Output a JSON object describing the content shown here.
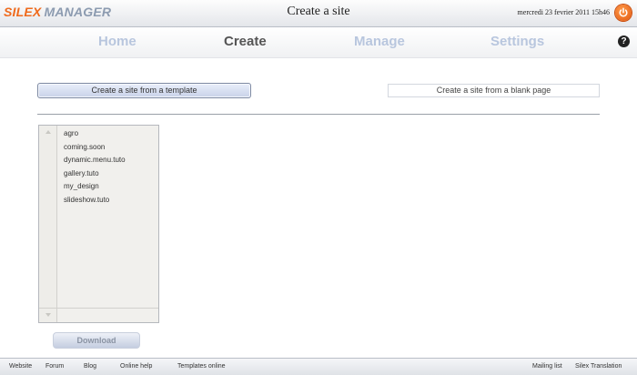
{
  "header": {
    "logo_part1": "SILEX",
    "logo_part2": "MANAGER",
    "title": "Create a site",
    "datetime": "mercredi 23 fevrier 2011 15h46",
    "power_icon": "power-icon"
  },
  "nav": {
    "tabs": [
      {
        "label": "Home"
      },
      {
        "label": "Create"
      },
      {
        "label": "Manage"
      },
      {
        "label": "Settings"
      }
    ],
    "active_tab": "Create",
    "help_label": "?"
  },
  "create": {
    "template_button": "Create a site from a template",
    "blank_button": "Create a site from a blank page"
  },
  "templates": {
    "items": [
      "agro",
      "coming.soon",
      "dynamic.menu.tuto",
      "gallery.tuto",
      "my_design",
      "slideshow.tuto"
    ]
  },
  "download": {
    "label": "Download"
  },
  "footer": {
    "left_links": [
      "Website",
      "Forum",
      "Blog",
      "Online help",
      "Templates online"
    ],
    "right_links": [
      "Mailing list",
      "Silex Translation"
    ]
  },
  "colors": {
    "accent_orange": "#ef6a1c",
    "tab_inactive": "#b8c6de",
    "tab_active": "#555555"
  }
}
